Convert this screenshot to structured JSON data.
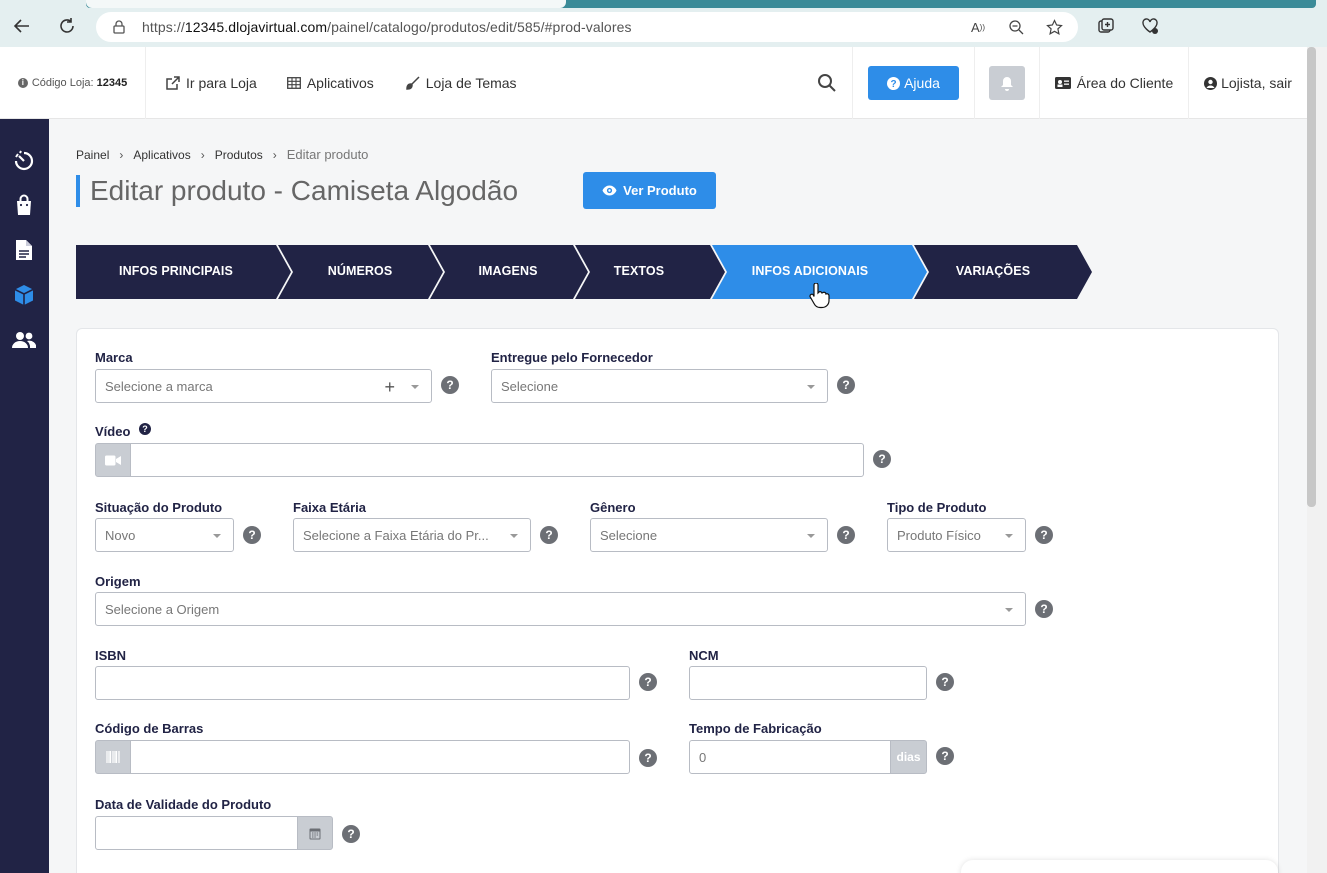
{
  "browser": {
    "url_prefix": "https://",
    "url_host": "12345.dlojavirtual.com",
    "url_path": "/painel/catalogo/produtos/edit/585/#prod-valores"
  },
  "header": {
    "store_code_label": "Código Loja:",
    "store_code_value": "12345",
    "links": [
      "Ir para Loja",
      "Aplicativos",
      "Loja de Temas"
    ],
    "help_label": "Ajuda",
    "client_area_label": "Área do Cliente",
    "user_label": "Lojista, sair"
  },
  "breadcrumb": [
    "Painel",
    "Aplicativos",
    "Produtos",
    "Editar produto"
  ],
  "page_title": "Editar produto - Camiseta Algodão",
  "view_product_label": "Ver Produto",
  "steps": [
    {
      "label": "INFOS PRINCIPAIS",
      "active": false
    },
    {
      "label": "NÚMEROS",
      "active": false
    },
    {
      "label": "IMAGENS",
      "active": false
    },
    {
      "label": "TEXTOS",
      "active": false
    },
    {
      "label": "INFOS ADICIONAIS",
      "active": true
    },
    {
      "label": "VARIAÇÕES",
      "active": false
    }
  ],
  "colors": {
    "accent": "#2e8de8",
    "sidebar": "#212345",
    "step_inactive": "#212345",
    "step_active": "#2e8de8"
  },
  "form": {
    "marca": {
      "label": "Marca",
      "placeholder": "Selecione a marca"
    },
    "fornecedor": {
      "label": "Entregue pelo Fornecedor",
      "placeholder": "Selecione"
    },
    "video": {
      "label": "Vídeo",
      "value": ""
    },
    "situacao": {
      "label": "Situação do Produto",
      "value": "Novo"
    },
    "faixa_etaria": {
      "label": "Faixa Etária",
      "placeholder": "Selecione a Faixa Etária do Pr..."
    },
    "genero": {
      "label": "Gênero",
      "placeholder": "Selecione"
    },
    "tipo_produto": {
      "label": "Tipo de Produto",
      "value": "Produto Físico"
    },
    "origem": {
      "label": "Origem",
      "placeholder": "Selecione a Origem"
    },
    "isbn": {
      "label": "ISBN",
      "value": ""
    },
    "ncm": {
      "label": "NCM",
      "value": ""
    },
    "codigo_barras": {
      "label": "Código de Barras",
      "value": ""
    },
    "tempo_fabricacao": {
      "label": "Tempo de Fabricação",
      "value": "0",
      "suffix": "dias"
    },
    "data_validade": {
      "label": "Data de Validade do Produto",
      "value": ""
    }
  }
}
